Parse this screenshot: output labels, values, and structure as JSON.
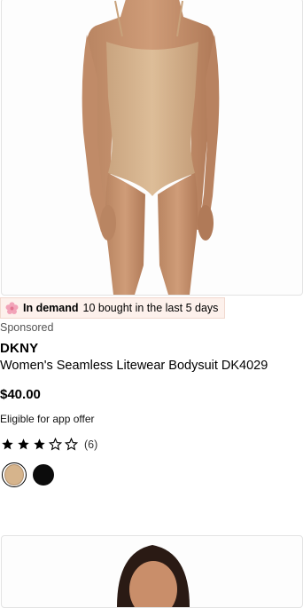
{
  "product": {
    "image_alt": "Model wearing a nude seamless bodysuit",
    "badge": {
      "icon": "flower-icon",
      "bold_text": "In demand",
      "text": "10 bought in the last 5 days"
    },
    "sponsored_label": "Sponsored",
    "brand": "DKNY",
    "title": "Women's Seamless Litewear Bodysuit DK4029",
    "price": "$40.00",
    "offer_text": "Eligible for app offer",
    "rating": {
      "stars": 3,
      "max": 5,
      "count_text": "(6)"
    },
    "swatches": [
      {
        "name": "nude",
        "color": "#d6b48c",
        "selected": true
      },
      {
        "name": "black",
        "color": "#0c0c0c",
        "selected": false
      }
    ]
  },
  "colors": {
    "badge_bg": "#fdf1ec",
    "star": "#000000"
  }
}
